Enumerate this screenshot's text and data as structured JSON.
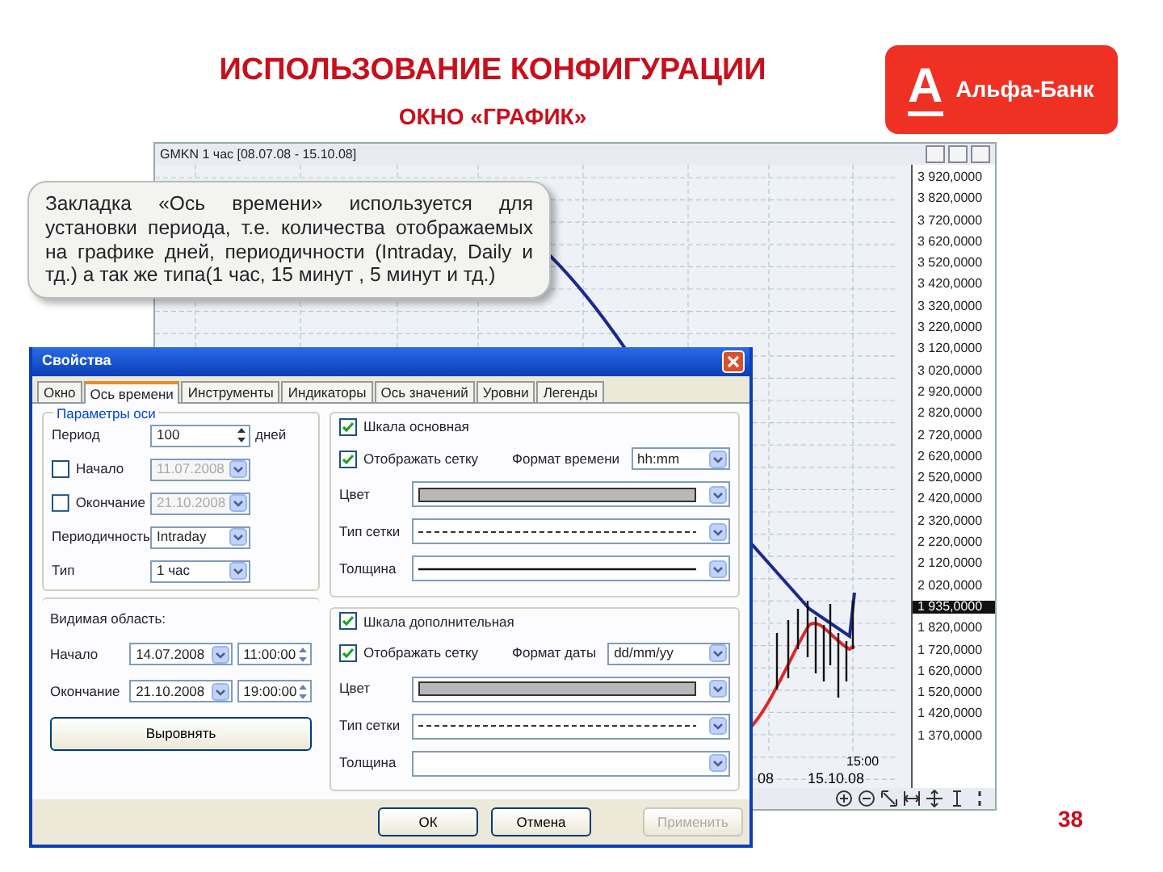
{
  "slide": {
    "title": "ИСПОЛЬЗОВАНИЕ КОНФИГУРАЦИИ",
    "subtitle": "ОКНО «ГРАФИК»",
    "logo": {
      "letter": "А",
      "text": "Альфа-Банк"
    },
    "page_number": "38"
  },
  "chart_window": {
    "title": "GMKN 1 час [08.07.08 - 15.10.08]",
    "y_labels": [
      "3 920,0000",
      "3 820,0000",
      "3 720,0000",
      "3 620,0000",
      "3 520,0000",
      "3 420,0000",
      "3 320,0000",
      "3 220,0000",
      "3 120,0000",
      "3 020,0000",
      "2 920,0000",
      "2 820,0000",
      "2 720,0000",
      "2 620,0000",
      "2 520,0000",
      "2 420,0000",
      "2 320,0000",
      "2 220,0000",
      "2 120,0000",
      "2 020,0000"
    ],
    "current_price": "1 935,0000",
    "y_labels_lower": [
      "1 820,0000",
      "1 720,0000",
      "1 620,0000",
      "1 520,0000",
      "1 420,0000",
      "1 370,0000"
    ],
    "x_labels": [
      "08",
      "15.10.08"
    ],
    "time_label": "15:00"
  },
  "callout": {
    "text": "Закладка «Ось времени» используется для установки периода, т.е. количества отображаемых на графике дней, периодичности (Intraday, Daily  и тд.) а так же типа(1 час, 15 минут , 5 минут и тд.)"
  },
  "dialog": {
    "title": "Свойства",
    "tabs": [
      {
        "label": "Окно",
        "selected": false
      },
      {
        "label": "Ось времени",
        "selected": true
      },
      {
        "label": "Инструменты",
        "selected": false
      },
      {
        "label": "Индикаторы",
        "selected": false
      },
      {
        "label": "Ось значений",
        "selected": false
      },
      {
        "label": "Уровни",
        "selected": false
      },
      {
        "label": "Легенды",
        "selected": false
      }
    ],
    "axis_group": {
      "legend": "Параметры оси",
      "rows": [
        {
          "kind": "spin",
          "label": "Период",
          "value": "100",
          "unit": "дней"
        },
        {
          "kind": "check-date",
          "label": "Начало",
          "checked": false,
          "value": "11.07.2008"
        },
        {
          "kind": "check-date",
          "label": "Окончание",
          "checked": false,
          "value": "21.10.2008"
        },
        {
          "kind": "select",
          "label": "Периодичность",
          "value": "Intraday"
        },
        {
          "kind": "select",
          "label": "Тип",
          "value": "1 час"
        }
      ]
    },
    "visible_area": {
      "label": "Видимая область:",
      "rows": [
        {
          "label": "Начало",
          "date": "14.07.2008",
          "time": "11:00:00"
        },
        {
          "label": "Окончание",
          "date": "21.10.2008",
          "time": "19:00:00"
        }
      ],
      "button": "Выровнять"
    },
    "scales": [
      {
        "label": "Шкала основная",
        "checked": true,
        "grid_label": "Отображать сетку",
        "grid_checked": true,
        "format_label": "Формат времени",
        "format_value": "hh:mm",
        "rows": [
          {
            "kind": "color",
            "label": "Цвет"
          },
          {
            "kind": "dash",
            "label": "Тип сетки"
          },
          {
            "kind": "line",
            "label": "Толщина"
          }
        ]
      },
      {
        "label": "Шкала дополнительная",
        "checked": true,
        "grid_label": "Отображать сетку",
        "grid_checked": true,
        "format_label": "Формат даты",
        "format_value": "dd/mm/yy",
        "rows": [
          {
            "kind": "color",
            "label": "Цвет"
          },
          {
            "kind": "dash",
            "label": "Тип сетки"
          },
          {
            "kind": "blank",
            "label": "Толщина"
          }
        ]
      }
    ],
    "buttons": [
      {
        "label": "ОК",
        "disabled": false
      },
      {
        "label": "Отмена",
        "disabled": false
      },
      {
        "label": "Применить",
        "disabled": true
      }
    ]
  }
}
